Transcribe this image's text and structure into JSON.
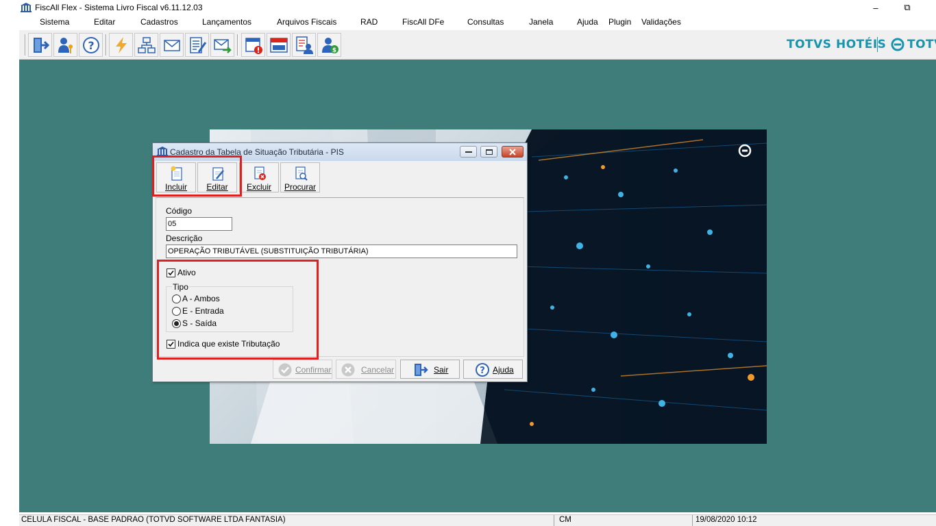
{
  "window": {
    "title": "FiscAll Flex - Sistema Livro Fiscal v6.11.12.03",
    "minimize_glyph": "–",
    "restore_glyph": "⧉"
  },
  "menu": {
    "items": [
      "Sistema",
      "Editar",
      "Cadastros",
      "Lançamentos",
      "Arquivos Fiscais",
      "RAD",
      "FiscAll DFe",
      "Consultas",
      "Janela",
      "Ajuda",
      "Plugin",
      "Validações"
    ]
  },
  "toolbar": {
    "buttons": [
      "exit-icon",
      "user-key-icon",
      "help-icon",
      "lightning-icon",
      "network-icon",
      "mail-icon",
      "checklist-icon",
      "mail-forward-icon",
      "calendar-alert-icon",
      "icms-calendar-icon",
      "document-user-icon",
      "user-money-icon"
    ],
    "brand_left": "TOTVS HOTÉIS",
    "brand_right": "TOTVS",
    "brand_color": "#1794b0"
  },
  "dialog": {
    "title": "Cadastro da Tabela de Situação Tributária - PIS",
    "toolbar": {
      "incluir": "Incluir",
      "editar": "Editar",
      "excluir": "Excluir",
      "procurar": "Procurar"
    },
    "form": {
      "codigo_label": "Código",
      "codigo_value": "05",
      "descricao_label": "Descrição",
      "descricao_value": "OPERAÇÃO TRIBUTÁVEL (SUBSTITUIÇÃO TRIBUTÁRIA)",
      "ativo_label": "Ativo",
      "ativo_checked": true,
      "tipo_label": "Tipo",
      "tipo_options": [
        "A - Ambos",
        "E - Entrada",
        "S - Saída"
      ],
      "tipo_selected": "S - Saída",
      "tributacao_label": "Indica que existe Tributação",
      "tributacao_checked": true
    },
    "footer": {
      "confirmar": "Confirmar",
      "cancelar": "Cancelar",
      "sair": "Sair",
      "ajuda": "Ajuda"
    }
  },
  "status": {
    "company": "CELULA FISCAL - BASE PADRAO (TOTVD SOFTWARE LTDA FANTASIA)",
    "code": "CM",
    "datetime": "19/08/2020 10:12"
  },
  "colors": {
    "workspace_bg": "#3f7d7b",
    "highlight": "#e02020"
  }
}
